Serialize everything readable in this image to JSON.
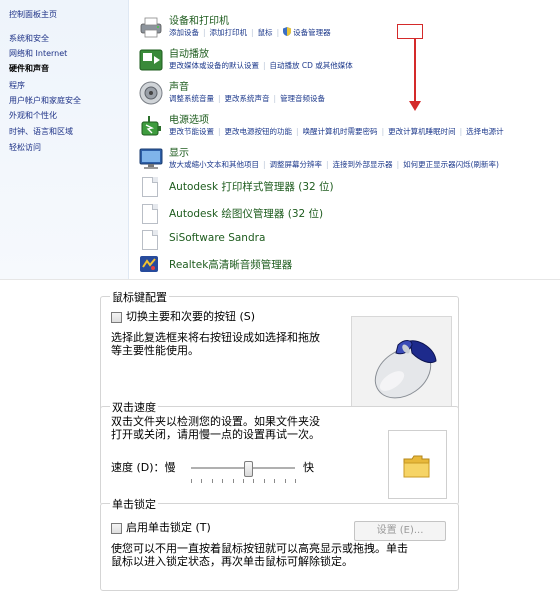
{
  "sidebar": {
    "items": [
      {
        "label": "控制面板主页"
      },
      {
        "label": "系统和安全"
      },
      {
        "label": "网络和 Internet"
      },
      {
        "label": "硬件和声音"
      },
      {
        "label": "程序"
      },
      {
        "label": "用户帐户和家庭安全"
      },
      {
        "label": "外观和个性化"
      },
      {
        "label": "时钟、语言和区域"
      },
      {
        "label": "轻松访问"
      }
    ]
  },
  "categories": [
    {
      "title": "设备和打印机",
      "links": [
        "添加设备",
        "添加打印机",
        "鼠标",
        "设备管理器"
      ],
      "icon": "printer-icon"
    },
    {
      "title": "自动播放",
      "links": [
        "更改媒体或设备的默认设置",
        "自动播放 CD 或其他媒体"
      ],
      "icon": "autoplay-icon"
    },
    {
      "title": "声音",
      "links": [
        "调整系统音量",
        "更改系统声音",
        "管理音频设备"
      ],
      "icon": "speaker-icon"
    },
    {
      "title": "电源选项",
      "links": [
        "更改节能设置",
        "更改电源按钮的功能",
        "唤醒计算机时需要密码",
        "更改计算机睡眠时间",
        "选择电源计"
      ],
      "icon": "power-icon"
    },
    {
      "title": "显示",
      "links": [
        "放大或缩小文本和其他项目",
        "调整屏幕分辨率",
        "连接到外部显示器",
        "如何更正显示器闪烁(刷新率)"
      ],
      "icon": "monitor-icon"
    }
  ],
  "programs": [
    {
      "label": "Autodesk 打印样式管理器 (32 位)"
    },
    {
      "label": "Autodesk 绘图仪管理器 (32 位)"
    },
    {
      "label": "SiSoftware Sandra"
    },
    {
      "label": "Realtek高清晰音频管理器"
    }
  ],
  "dialog": {
    "button_config": {
      "title": "鼠标键配置",
      "swap_label": "切换主要和次要的按钮 (S)",
      "desc_line1": "选择此复选框来将右按钮设成如选择和拖放",
      "desc_line2": "等主要性能使用。"
    },
    "double_click": {
      "title": "双击速度",
      "desc_line1": "双击文件夹以检测您的设置。如果文件夹没",
      "desc_line2": "打开或关闭，请用慢一点的设置再试一次。",
      "speed_label": "速度 (D)：慢",
      "fast_label": "快",
      "speed_level": 0.55
    },
    "click_lock": {
      "title": "单击锁定",
      "enable_label": "启用单击锁定 (T)",
      "settings_button": "设置 (E)...",
      "desc_line1": "使您可以不用一直按着鼠标按钮就可以高亮显示或拖拽。单击",
      "desc_line2": "鼠标以进入锁定状态，再次单击鼠标可解除锁定。"
    }
  },
  "colors": {
    "annotation": "#d42a2a",
    "link": "#1e3a8c",
    "category_title": "#1e5c1e"
  }
}
